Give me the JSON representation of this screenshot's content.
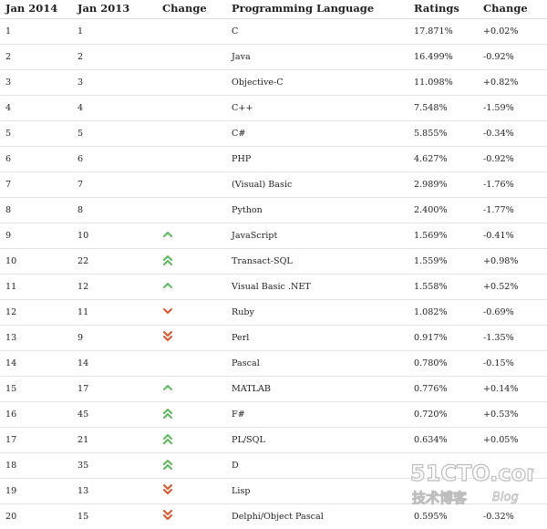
{
  "header": {
    "col_jan2014": "Jan 2014",
    "col_jan2013": "Jan 2013",
    "col_change": "Change",
    "col_language": "Programming Language",
    "col_ratings": "Ratings",
    "col_ratings_change": "Change"
  },
  "colors": {
    "up": "#5cb85c",
    "down": "#e2542a"
  },
  "rows": [
    {
      "jan2014": "1",
      "jan2013": "1",
      "trend": "none",
      "language": "C",
      "rating": "17.871%",
      "change": "+0.02%"
    },
    {
      "jan2014": "2",
      "jan2013": "2",
      "trend": "none",
      "language": "Java",
      "rating": "16.499%",
      "change": "-0.92%"
    },
    {
      "jan2014": "3",
      "jan2013": "3",
      "trend": "none",
      "language": "Objective-C",
      "rating": "11.098%",
      "change": "+0.82%"
    },
    {
      "jan2014": "4",
      "jan2013": "4",
      "trend": "none",
      "language": "C++",
      "rating": "7.548%",
      "change": "-1.59%"
    },
    {
      "jan2014": "5",
      "jan2013": "5",
      "trend": "none",
      "language": "C#",
      "rating": "5.855%",
      "change": "-0.34%"
    },
    {
      "jan2014": "6",
      "jan2013": "6",
      "trend": "none",
      "language": "PHP",
      "rating": "4.627%",
      "change": "-0.92%"
    },
    {
      "jan2014": "7",
      "jan2013": "7",
      "trend": "none",
      "language": "(Visual) Basic",
      "rating": "2.989%",
      "change": "-1.76%"
    },
    {
      "jan2014": "8",
      "jan2013": "8",
      "trend": "none",
      "language": "Python",
      "rating": "2.400%",
      "change": "-1.77%"
    },
    {
      "jan2014": "9",
      "jan2013": "10",
      "trend": "up",
      "language": "JavaScript",
      "rating": "1.569%",
      "change": "-0.41%"
    },
    {
      "jan2014": "10",
      "jan2013": "22",
      "trend": "double-up",
      "language": "Transact-SQL",
      "rating": "1.559%",
      "change": "+0.98%"
    },
    {
      "jan2014": "11",
      "jan2013": "12",
      "trend": "up",
      "language": "Visual Basic .NET",
      "rating": "1.558%",
      "change": "+0.52%"
    },
    {
      "jan2014": "12",
      "jan2013": "11",
      "trend": "down",
      "language": "Ruby",
      "rating": "1.082%",
      "change": "-0.69%"
    },
    {
      "jan2014": "13",
      "jan2013": "9",
      "trend": "double-down",
      "language": "Perl",
      "rating": "0.917%",
      "change": "-1.35%"
    },
    {
      "jan2014": "14",
      "jan2013": "14",
      "trend": "none",
      "language": "Pascal",
      "rating": "0.780%",
      "change": "-0.15%"
    },
    {
      "jan2014": "15",
      "jan2013": "17",
      "trend": "up",
      "language": "MATLAB",
      "rating": "0.776%",
      "change": "+0.14%"
    },
    {
      "jan2014": "16",
      "jan2013": "45",
      "trend": "double-up",
      "language": "F#",
      "rating": "0.720%",
      "change": "+0.53%"
    },
    {
      "jan2014": "17",
      "jan2013": "21",
      "trend": "double-up",
      "language": "PL/SQL",
      "rating": "0.634%",
      "change": "+0.05%"
    },
    {
      "jan2014": "18",
      "jan2013": "35",
      "trend": "double-up",
      "language": "D",
      "rating": "",
      "change": ""
    },
    {
      "jan2014": "19",
      "jan2013": "13",
      "trend": "double-down",
      "language": "Lisp",
      "rating": "",
      "change": ""
    },
    {
      "jan2014": "20",
      "jan2013": "15",
      "trend": "double-down",
      "language": "Delphi/Object Pascal",
      "rating": "0.595%",
      "change": "-0.32%"
    }
  ],
  "watermark": {
    "site": "51CTO.com",
    "tagline": "技术博客",
    "blog": "Blog"
  }
}
